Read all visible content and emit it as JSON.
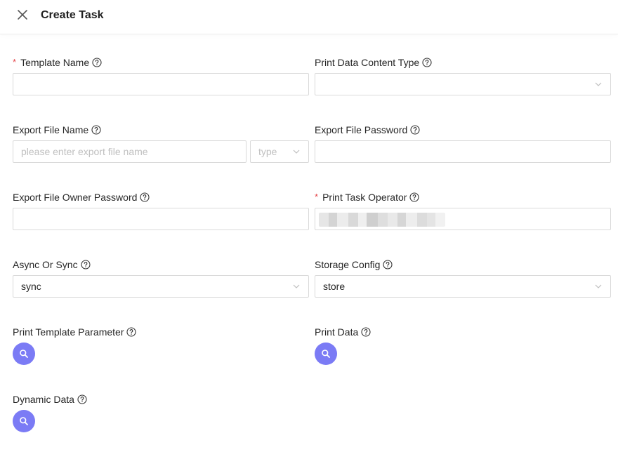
{
  "header": {
    "title": "Create Task"
  },
  "form": {
    "template_name": {
      "label": "Template Name",
      "required": true,
      "value": ""
    },
    "print_data_content_type": {
      "label": "Print Data Content Type",
      "value": ""
    },
    "export_file_name": {
      "label": "Export File Name",
      "placeholder": "please enter export file name",
      "type_placeholder": "type"
    },
    "export_file_password": {
      "label": "Export File Password",
      "value": ""
    },
    "export_file_owner_password": {
      "label": "Export File Owner Password",
      "value": ""
    },
    "print_task_operator": {
      "label": "Print Task Operator",
      "required": true
    },
    "async_or_sync": {
      "label": "Async Or Sync",
      "value": "sync"
    },
    "storage_config": {
      "label": "Storage Config",
      "value": "store"
    },
    "print_template_parameter": {
      "label": "Print Template Parameter"
    },
    "print_data": {
      "label": "Print Data"
    },
    "dynamic_data": {
      "label": "Dynamic Data"
    }
  },
  "icons": {
    "close": "close-icon",
    "help": "question-circle-icon",
    "chevron": "chevron-down-icon",
    "search": "search-icon"
  },
  "colors": {
    "required": "#e5484d",
    "search_button": "#7b7bf5",
    "border": "#d9d9d9"
  }
}
